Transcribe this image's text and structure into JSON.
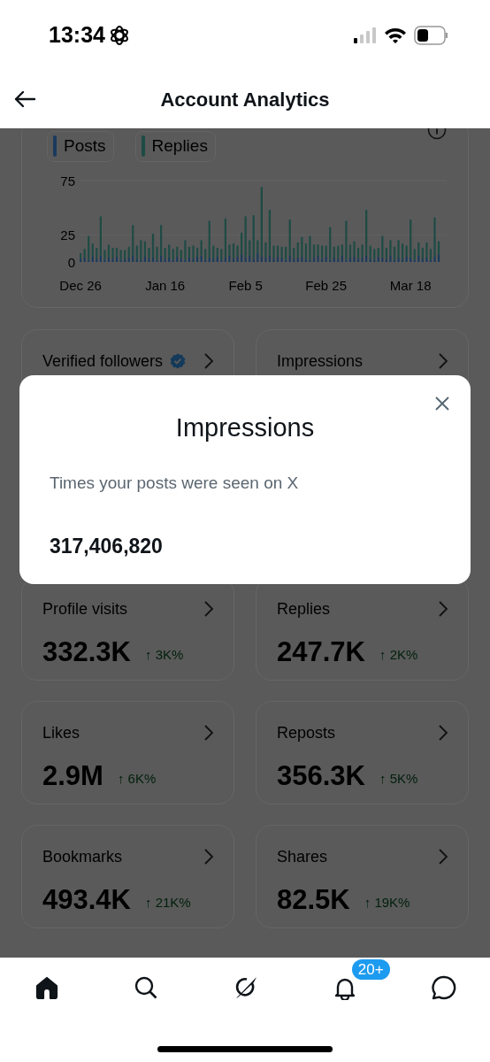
{
  "status_bar": {
    "time": "13:34"
  },
  "header": {
    "title": "Account Analytics"
  },
  "chart_card": {
    "chart_data": {
      "type": "bar",
      "stacked": true,
      "categories": [
        "Dec 26",
        null,
        null,
        null,
        null,
        null,
        null,
        null,
        null,
        null,
        null,
        null,
        null,
        null,
        null,
        null,
        null,
        null,
        null,
        null,
        null,
        "Jan 16",
        null,
        null,
        null,
        null,
        null,
        null,
        null,
        null,
        null,
        null,
        null,
        null,
        null,
        null,
        null,
        null,
        null,
        null,
        null,
        "Feb 5",
        null,
        null,
        null,
        null,
        null,
        null,
        null,
        null,
        null,
        null,
        null,
        null,
        null,
        null,
        null,
        null,
        null,
        null,
        null,
        "Feb 25",
        null,
        null,
        null,
        null,
        null,
        null,
        null,
        null,
        null,
        null,
        null,
        null,
        null,
        null,
        null,
        null,
        null,
        null,
        null,
        null,
        "Mar 18",
        null,
        null,
        null,
        null,
        null,
        null,
        null
      ],
      "ylim": [
        0,
        75
      ],
      "series": [
        {
          "name": "Posts",
          "color": "#1a3a5c",
          "values": [
            3,
            4,
            2,
            5,
            3,
            6,
            2,
            4,
            3,
            5,
            2,
            3,
            4,
            6,
            3,
            2,
            5,
            3,
            4,
            2,
            6,
            3,
            4,
            2,
            5,
            3,
            2,
            4,
            3,
            5,
            6,
            2,
            4,
            3,
            5,
            2,
            4,
            6,
            3,
            5,
            7,
            4,
            6,
            3,
            8,
            5,
            4,
            6,
            3,
            5,
            4,
            2,
            6,
            3,
            4,
            5,
            3,
            2,
            4,
            6,
            3,
            5,
            2,
            4,
            3,
            6,
            2,
            4,
            5,
            3,
            4,
            6,
            3,
            2,
            5,
            4,
            3,
            6,
            2,
            4,
            3,
            5,
            4,
            2,
            6,
            3,
            4,
            2,
            5,
            7
          ]
        },
        {
          "name": "Replies",
          "color": "#1e4b44",
          "values": [
            5,
            8,
            22,
            12,
            10,
            36,
            9,
            12,
            10,
            8,
            9,
            8,
            10,
            28,
            12,
            18,
            14,
            10,
            22,
            12,
            28,
            10,
            12,
            10,
            9,
            8,
            18,
            10,
            12,
            8,
            14,
            10,
            34,
            12,
            8,
            10,
            36,
            10,
            14,
            10,
            20,
            38,
            14,
            40,
            12,
            64,
            14,
            42,
            12,
            10,
            10,
            12,
            33,
            10,
            14,
            18,
            14,
            22,
            12,
            10,
            12,
            10,
            30,
            10,
            12,
            10,
            36,
            12,
            14,
            10,
            12,
            42,
            12,
            10,
            8,
            20,
            10,
            14,
            12,
            16,
            14,
            10,
            35,
            10,
            12,
            10,
            14,
            10,
            36,
            12
          ]
        }
      ],
      "yticks": [
        0,
        25,
        75
      ]
    }
  },
  "metric_cards": [
    {
      "label": "Verified followers",
      "verified": true
    },
    {
      "label": "Impressions",
      "verified": false
    },
    {
      "label": "Profile visits",
      "value": "332.3K",
      "change": "↑ 3K%"
    },
    {
      "label": "Replies",
      "value": "247.7K",
      "change": "↑ 2K%"
    },
    {
      "label": "Likes",
      "value": "2.9M",
      "change": "↑ 6K%"
    },
    {
      "label": "Reposts",
      "value": "356.3K",
      "change": "↑ 5K%"
    },
    {
      "label": "Bookmarks",
      "value": "493.4K",
      "change": "↑ 21K%"
    },
    {
      "label": "Shares",
      "value": "82.5K",
      "change": "↑ 19K%"
    }
  ],
  "dialog": {
    "title": "Impressions",
    "description": "Times your posts were seen on X",
    "value": "317,406,820"
  },
  "bottom_nav": [
    {
      "kind": "home",
      "selected": true
    },
    {
      "kind": "search",
      "selected": false
    },
    {
      "kind": "grok",
      "selected": false
    },
    {
      "kind": "notifications",
      "selected": false,
      "badge": "20+"
    },
    {
      "kind": "messages",
      "selected": false
    }
  ]
}
